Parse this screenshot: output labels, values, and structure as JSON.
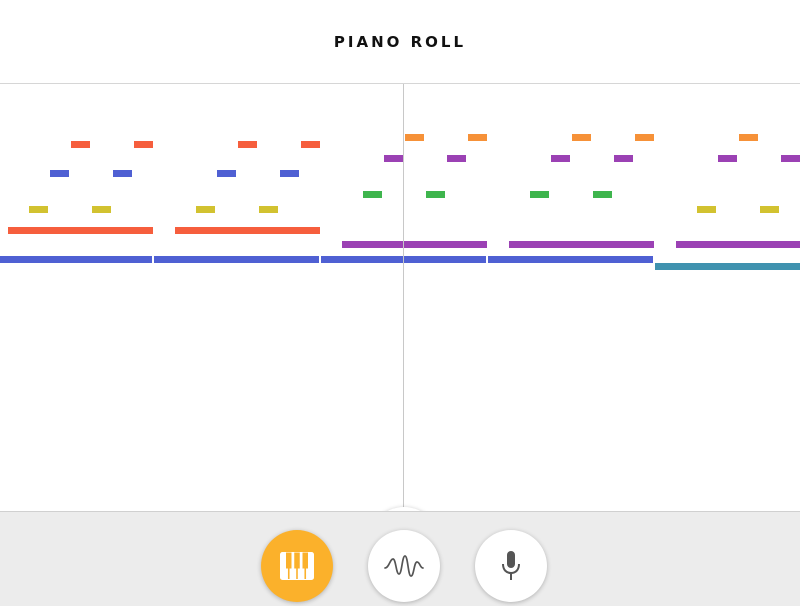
{
  "header": {
    "title": "PIANO ROLL"
  },
  "colors": {
    "red": "#f65e3d",
    "blue": "#4f60d3",
    "yellow": "#d2c230",
    "orange": "#f69138",
    "purple": "#9b41b4",
    "green": "#3eb54d",
    "teal": "#3f92af",
    "accent": "#fbb12b"
  },
  "controls": {
    "play_icon": "play-icon",
    "next_icon": "arrow-right-icon"
  },
  "footer": {
    "modes": [
      {
        "name": "piano-mode",
        "icon": "piano-keys-icon",
        "active": true
      },
      {
        "name": "waveform-mode",
        "icon": "waveform-icon",
        "active": false
      },
      {
        "name": "microphone-mode",
        "icon": "microphone-icon",
        "active": false
      }
    ]
  }
}
